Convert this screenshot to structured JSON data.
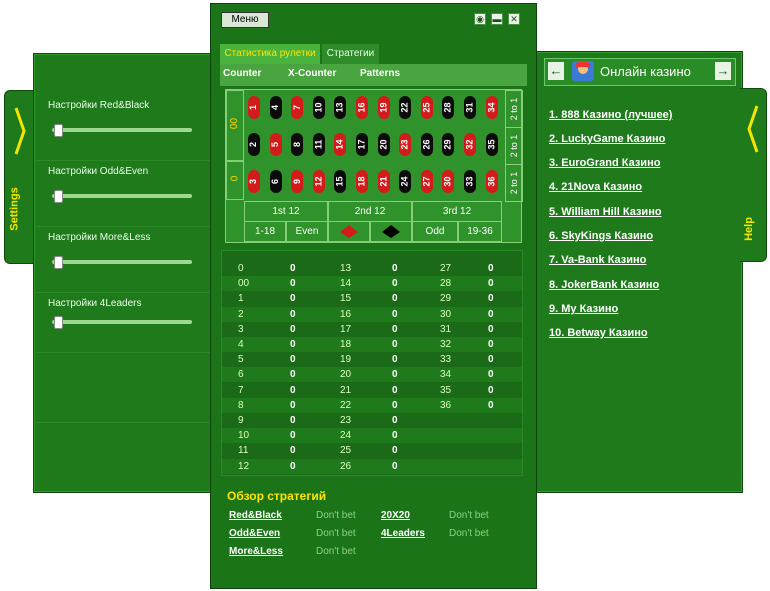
{
  "window": {
    "menu_label": "Меню",
    "controls": [
      "pin-icon",
      "minimize-icon",
      "close-icon"
    ]
  },
  "left": {
    "tab_label": "Settings",
    "settings": [
      {
        "label": "Настройки Red&Black",
        "level": 0
      },
      {
        "label": "Настройки Odd&Even",
        "level": 0
      },
      {
        "label": "Настройки More&Less",
        "level": 0
      },
      {
        "label": "Настройки 4Leaders",
        "level": 0
      }
    ]
  },
  "right": {
    "tab_label": "Help",
    "casino_title": "Онлайн казино",
    "casinos": [
      "1. 888 Казино (лучшее)",
      "2. LuckyGame Казино",
      "3. EuroGrand Казино",
      "4. 21Nova Казино",
      "5. William Hill Казино",
      "6. SkyKings Казино",
      "7. Va-Bank Казино",
      "8. JokerBank Казино",
      "9. My Казино",
      "10. Betway Казино"
    ]
  },
  "main": {
    "tabs": [
      "Статистика рулетки",
      "Стратегии"
    ],
    "subtabs": [
      "Counter",
      "X-Counter",
      "Patterns"
    ],
    "table": {
      "zeros": [
        "00",
        "0"
      ],
      "rows": [
        [
          {
            "n": "3",
            "c": "red"
          },
          {
            "n": "6",
            "c": "black"
          },
          {
            "n": "9",
            "c": "red"
          },
          {
            "n": "12",
            "c": "red"
          },
          {
            "n": "15",
            "c": "black"
          },
          {
            "n": "18",
            "c": "red"
          },
          {
            "n": "21",
            "c": "red"
          },
          {
            "n": "24",
            "c": "black"
          },
          {
            "n": "27",
            "c": "red"
          },
          {
            "n": "30",
            "c": "red"
          },
          {
            "n": "33",
            "c": "black"
          },
          {
            "n": "36",
            "c": "red"
          }
        ],
        [
          {
            "n": "2",
            "c": "black"
          },
          {
            "n": "5",
            "c": "red"
          },
          {
            "n": "8",
            "c": "black"
          },
          {
            "n": "11",
            "c": "black"
          },
          {
            "n": "14",
            "c": "red"
          },
          {
            "n": "17",
            "c": "black"
          },
          {
            "n": "20",
            "c": "black"
          },
          {
            "n": "23",
            "c": "red"
          },
          {
            "n": "26",
            "c": "black"
          },
          {
            "n": "29",
            "c": "black"
          },
          {
            "n": "32",
            "c": "red"
          },
          {
            "n": "35",
            "c": "black"
          }
        ],
        [
          {
            "n": "1",
            "c": "red"
          },
          {
            "n": "4",
            "c": "black"
          },
          {
            "n": "7",
            "c": "red"
          },
          {
            "n": "10",
            "c": "black"
          },
          {
            "n": "13",
            "c": "black"
          },
          {
            "n": "16",
            "c": "red"
          },
          {
            "n": "19",
            "c": "red"
          },
          {
            "n": "22",
            "c": "black"
          },
          {
            "n": "25",
            "c": "red"
          },
          {
            "n": "28",
            "c": "black"
          },
          {
            "n": "31",
            "c": "black"
          },
          {
            "n": "34",
            "c": "red"
          }
        ]
      ],
      "col_bets": [
        "2 to 1",
        "2 to 1",
        "2 to 1"
      ],
      "dozens": [
        "1st 12",
        "2nd 12",
        "3rd 12"
      ],
      "outside": [
        "1-18",
        "Even",
        "",
        "",
        "Odd",
        "19-36"
      ]
    },
    "counter": [
      [
        "0",
        "0",
        "13",
        "0",
        "27",
        "0"
      ],
      [
        "00",
        "0",
        "14",
        "0",
        "28",
        "0"
      ],
      [
        "1",
        "0",
        "15",
        "0",
        "29",
        "0"
      ],
      [
        "2",
        "0",
        "16",
        "0",
        "30",
        "0"
      ],
      [
        "3",
        "0",
        "17",
        "0",
        "31",
        "0"
      ],
      [
        "4",
        "0",
        "18",
        "0",
        "32",
        "0"
      ],
      [
        "5",
        "0",
        "19",
        "0",
        "33",
        "0"
      ],
      [
        "6",
        "0",
        "20",
        "0",
        "34",
        "0"
      ],
      [
        "7",
        "0",
        "21",
        "0",
        "35",
        "0"
      ],
      [
        "8",
        "0",
        "22",
        "0",
        "36",
        "0"
      ],
      [
        "9",
        "0",
        "23",
        "0",
        "",
        ""
      ],
      [
        "10",
        "0",
        "24",
        "0",
        "",
        ""
      ],
      [
        "11",
        "0",
        "25",
        "0",
        "",
        ""
      ],
      [
        "12",
        "0",
        "26",
        "0",
        "",
        ""
      ]
    ],
    "overview_title": "Обзор стратегий",
    "strategies": [
      {
        "name": "Red&Black",
        "status": "Don't bet"
      },
      {
        "name": "Odd&Even",
        "status": "Don't bet"
      },
      {
        "name": "More&Less",
        "status": "Don't bet"
      },
      {
        "name": "20X20",
        "status": "Don't bet"
      },
      {
        "name": "4Leaders",
        "status": "Don't bet"
      }
    ]
  }
}
